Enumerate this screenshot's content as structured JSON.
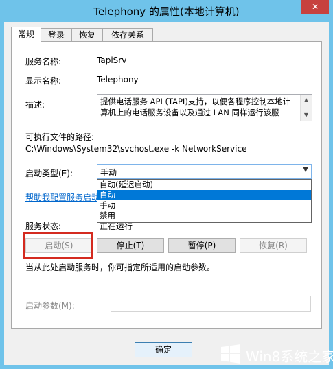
{
  "window": {
    "title": "Telephony 的属性(本地计算机)",
    "close_label": "✕"
  },
  "tabs": [
    "常规",
    "登录",
    "恢复",
    "依存关系"
  ],
  "general": {
    "service_name_label": "服务名称:",
    "service_name_value": "TapiSrv",
    "display_name_label": "显示名称:",
    "display_name_value": "Telephony",
    "description_label": "描述:",
    "description_value": "提供电话服务 API (TAPI)支持，以便各程序控制本地计算机上的电话服务设备以及通过 LAN 同样运行该服",
    "exe_path_label": "可执行文件的路径:",
    "exe_path_value": "C:\\Windows\\System32\\svchost.exe -k NetworkService",
    "startup_type_label": "启动类型(E):",
    "startup_type_value": "手动",
    "startup_type_options": [
      "自动(延迟启动)",
      "自动",
      "手动",
      "禁用"
    ],
    "startup_type_highlighted": "自动",
    "help_link": "帮助我配置服务启动选项。",
    "service_status_label": "服务状态:",
    "service_status_value": "正在运行",
    "buttons": {
      "start": "启动(S)",
      "stop": "停止(T)",
      "pause": "暂停(P)",
      "resume": "恢复(R)"
    },
    "hint": "当从此处启动服务时，你可指定所适用的启动参数。",
    "start_params_label": "启动参数(M):",
    "start_params_value": ""
  },
  "footer": {
    "ok_label": "确定"
  },
  "watermark": {
    "text": "Win8系统之家"
  },
  "colors": {
    "title_bar": "#6fc3ea",
    "close_button": "#c7413e",
    "highlight_border": "#d42a1f",
    "selected_item": "#0078d7",
    "link": "#0066cc"
  }
}
